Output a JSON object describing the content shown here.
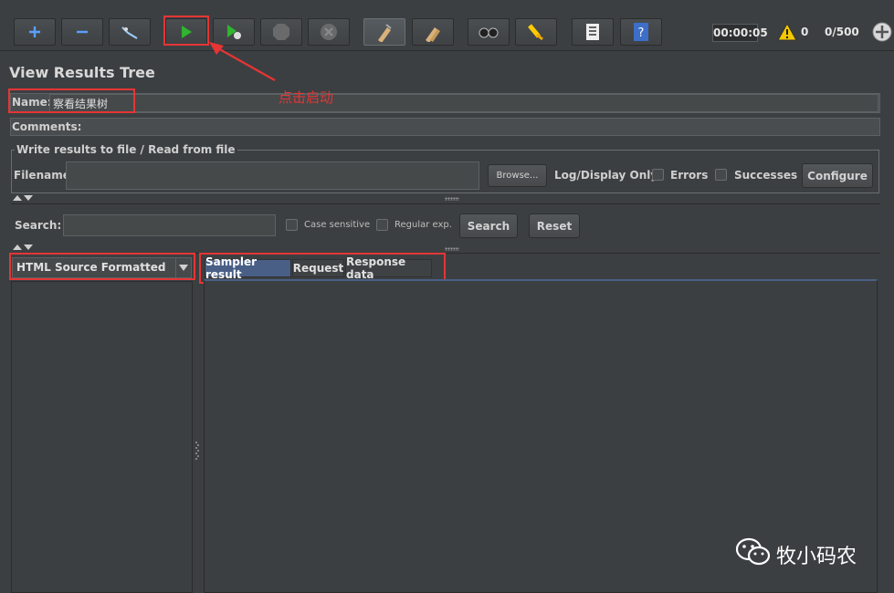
{
  "toolbar": {
    "timer": "00:00:05",
    "warning_count": "0",
    "threads": "0/500",
    "icons": [
      "add-icon",
      "remove-icon",
      "toggle-icon",
      "start-icon",
      "start-no-pause-icon",
      "stop-icon",
      "shutdown-icon",
      "clear-icon",
      "clear-all-icon",
      "search-icon",
      "reset-search-icon",
      "function-helper-icon",
      "help-icon",
      "warning-icon",
      "remote-start-all-icon"
    ]
  },
  "panel": {
    "title": "View Results Tree",
    "name_label": "Name:",
    "name_value": "察看结果树",
    "comments_label": "Comments:",
    "annotation": "点击启动"
  },
  "file_section": {
    "legend": "Write results to file / Read from file",
    "filename_label": "Filename",
    "browse_label": "Browse...",
    "log_display_label": "Log/Display Only:",
    "errors_label": "Errors",
    "successes_label": "Successes",
    "configure_label": "Configure"
  },
  "search": {
    "label": "Search:",
    "case_sensitive_label": "Case sensitive",
    "regex_label": "Regular exp.",
    "search_button": "Search",
    "reset_button": "Reset"
  },
  "renderer": {
    "selected": "HTML Source Formatted"
  },
  "tabs": [
    "Sampler result",
    "Request",
    "Response data"
  ],
  "watermark": "牧小码农",
  "colors": {
    "background": "#3c3f41",
    "highlight": "#e53535",
    "active_tab": "#4a5f86"
  }
}
